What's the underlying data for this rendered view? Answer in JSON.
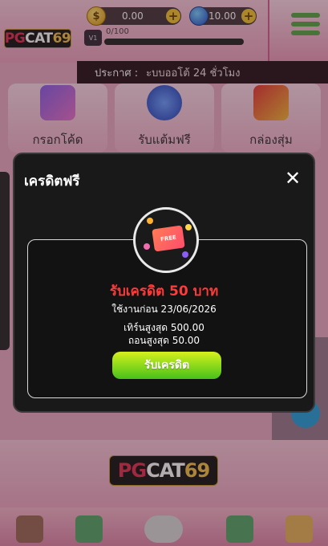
{
  "wallet": {
    "coins": "0.00",
    "gems": "10.00"
  },
  "profile": {
    "level_label": "V1",
    "xp": "0/100",
    "xp_progress": 0
  },
  "logo": {
    "part1": "PG",
    "part2": "CAT",
    "part3": "69"
  },
  "announcement": {
    "label": "ประกาศ :",
    "message": "ะบบออโต้ 24 ชั่วโมง"
  },
  "tiles": [
    {
      "label": "กรอกโค้ด",
      "icon": "code-coupon-icon"
    },
    {
      "label": "รับแต้มฟรี",
      "icon": "gem-icon"
    },
    {
      "label": "กล่องสุ่ม",
      "icon": "mystery-box-icon"
    }
  ],
  "modal": {
    "title": "เครดิตฟรี",
    "badge_text": "FREE",
    "reward": "รับเครดิต 50 บาท",
    "expire": "ใช้งานก่อน 23/06/2026",
    "turnover": "เทิร์นสูงสุด 500.00",
    "withdraw": "ถอนสูงสุด 50.00",
    "claim_label": "รับเครดิต"
  },
  "colors": {
    "reward_red": "#ff3a3a",
    "claim_green_top": "#d6f01d",
    "claim_green_bottom": "#47c21a",
    "background_pink": "#e8a9c2"
  }
}
